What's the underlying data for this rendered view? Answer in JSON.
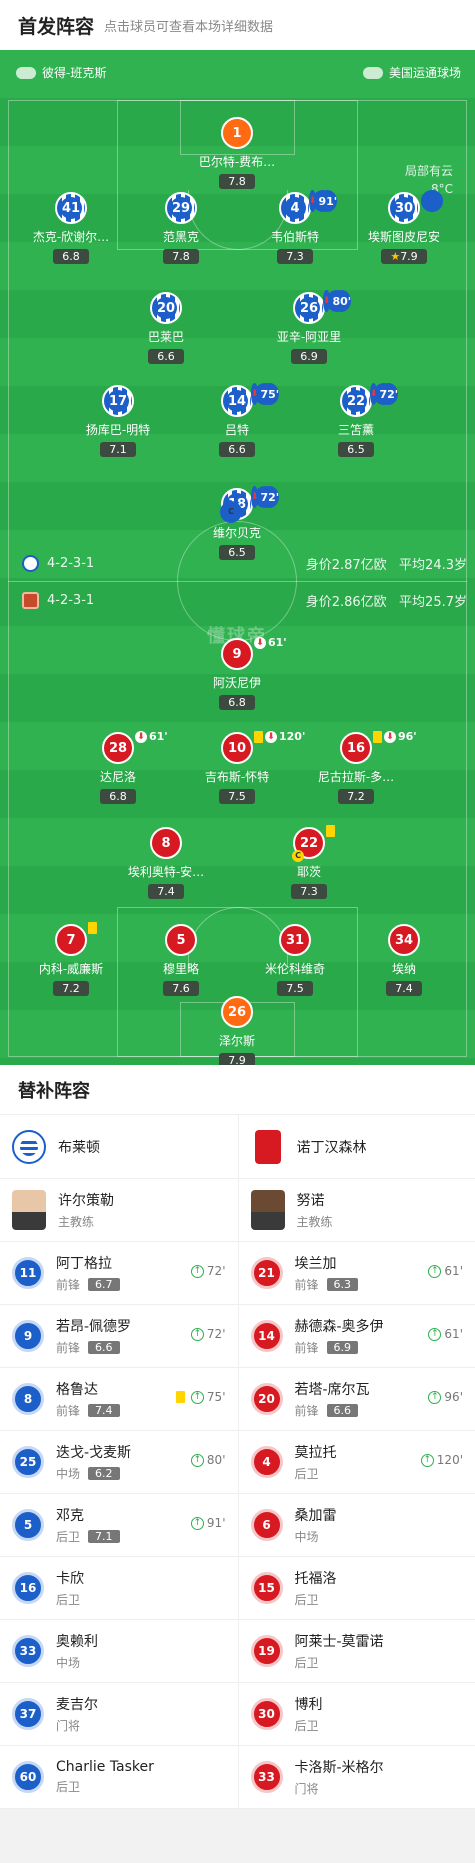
{
  "header": {
    "title": "首发阵容",
    "subtitle": "点击球员可查看本场详细数据"
  },
  "pitch": {
    "referee": "彼得-班克斯",
    "stadium": "美国运通球场",
    "weather": "局部有云",
    "temperature": "8°C",
    "watermark": "懂球帝",
    "home_info": {
      "formation": "4-2-3-1",
      "value": "身价2.87亿欧",
      "age": "平均24.3岁"
    },
    "away_info": {
      "formation": "4-2-3-1",
      "value": "身价2.86亿欧",
      "age": "平均25.7岁"
    }
  },
  "home_players": [
    {
      "num": "1",
      "name": "巴尔特-费布…",
      "rating": "7.8",
      "gk": true
    },
    {
      "num": "41",
      "name": "杰克-欣谢尔…",
      "rating": "6.8"
    },
    {
      "num": "29",
      "name": "范黑克",
      "rating": "7.8"
    },
    {
      "num": "4",
      "name": "韦伯斯特",
      "rating": "7.3",
      "sub": "91'"
    },
    {
      "num": "30",
      "name": "埃斯图皮尼安",
      "rating": "7.9",
      "card": true,
      "star": true
    },
    {
      "num": "20",
      "name": "巴莱巴",
      "rating": "6.6"
    },
    {
      "num": "26",
      "name": "亚辛-阿亚里",
      "rating": "6.9",
      "sub": "80'"
    },
    {
      "num": "17",
      "name": "扬库巴-明特",
      "rating": "7.1"
    },
    {
      "num": "14",
      "name": "吕特",
      "rating": "6.6",
      "sub": "75'"
    },
    {
      "num": "22",
      "name": "三笘薰",
      "rating": "6.5",
      "sub": "72'"
    },
    {
      "num": "18",
      "name": "维尔贝克",
      "rating": "6.5",
      "sub": "72'",
      "captain": true
    }
  ],
  "away_players": [
    {
      "num": "9",
      "name": "阿沃尼伊",
      "rating": "6.8",
      "sub": "61'"
    },
    {
      "num": "28",
      "name": "达尼洛",
      "rating": "6.8",
      "sub": "61'"
    },
    {
      "num": "10",
      "name": "吉布斯-怀特",
      "rating": "7.5",
      "sub": "120'",
      "card": true
    },
    {
      "num": "16",
      "name": "尼古拉斯-多…",
      "rating": "7.2",
      "sub": "96'",
      "card": true
    },
    {
      "num": "8",
      "name": "埃利奥特-安…",
      "rating": "7.4"
    },
    {
      "num": "22",
      "name": "耶茨",
      "rating": "7.3",
      "card": true,
      "captain": true
    },
    {
      "num": "7",
      "name": "内科-威廉斯",
      "rating": "7.2",
      "card": true
    },
    {
      "num": "5",
      "name": "穆里略",
      "rating": "7.6"
    },
    {
      "num": "31",
      "name": "米伦科维奇",
      "rating": "7.5"
    },
    {
      "num": "34",
      "name": "埃纳",
      "rating": "7.4"
    },
    {
      "num": "26",
      "name": "泽尔斯",
      "rating": "7.9",
      "gk": true
    }
  ],
  "captain_mark": "C",
  "subs_title": "替补阵容",
  "home_team": {
    "name": "布莱顿",
    "coach_name": "许尔策勒",
    "coach_role": "主教练"
  },
  "away_team": {
    "name": "诺丁汉森林",
    "coach_name": "努诺",
    "coach_role": "主教练"
  },
  "home_subs": [
    {
      "num": "11",
      "name": "阿丁格拉",
      "pos": "前锋",
      "rating": "6.7",
      "in": "72'"
    },
    {
      "num": "9",
      "name": "若昂-佩德罗",
      "pos": "前锋",
      "rating": "6.6",
      "in": "72'"
    },
    {
      "num": "8",
      "name": "格鲁达",
      "pos": "前锋",
      "rating": "7.4",
      "in": "75'",
      "card": true
    },
    {
      "num": "25",
      "name": "迭戈-戈麦斯",
      "pos": "中场",
      "rating": "6.2",
      "in": "80'"
    },
    {
      "num": "5",
      "name": "邓克",
      "pos": "后卫",
      "rating": "7.1",
      "in": "91'"
    },
    {
      "num": "16",
      "name": "卡欣",
      "pos": "后卫"
    },
    {
      "num": "33",
      "name": "奥赖利",
      "pos": "中场"
    },
    {
      "num": "37",
      "name": "麦吉尔",
      "pos": "门将"
    },
    {
      "num": "60",
      "name": "Charlie Tasker",
      "pos": "后卫"
    }
  ],
  "away_subs": [
    {
      "num": "21",
      "name": "埃兰加",
      "pos": "前锋",
      "rating": "6.3",
      "in": "61'"
    },
    {
      "num": "14",
      "name": "赫德森-奥多伊",
      "pos": "前锋",
      "rating": "6.9",
      "in": "61'"
    },
    {
      "num": "20",
      "name": "若塔-席尔瓦",
      "pos": "前锋",
      "rating": "6.6",
      "in": "96'"
    },
    {
      "num": "4",
      "name": "莫拉托",
      "pos": "后卫",
      "in": "120'"
    },
    {
      "num": "6",
      "name": "桑加雷",
      "pos": "中场"
    },
    {
      "num": "15",
      "name": "托福洛",
      "pos": "后卫"
    },
    {
      "num": "19",
      "name": "阿莱士-莫雷诺",
      "pos": "后卫"
    },
    {
      "num": "30",
      "name": "博利",
      "pos": "后卫"
    },
    {
      "num": "33",
      "name": "卡洛斯-米格尔",
      "pos": "门将"
    }
  ]
}
